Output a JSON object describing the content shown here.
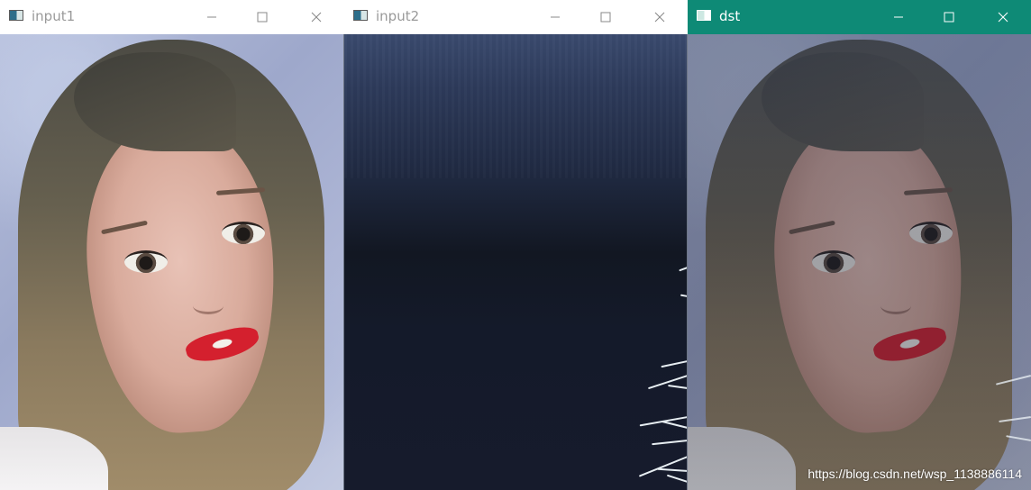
{
  "windows": [
    {
      "title": "input1",
      "active": false,
      "image": "girl-portrait"
    },
    {
      "title": "input2",
      "active": false,
      "image": "dark-blue-background"
    },
    {
      "title": "dst",
      "active": true,
      "image": "blended-portrait",
      "watermark": "https://blog.csdn.net/wsp_1138886114"
    }
  ],
  "colors": {
    "active_titlebar": "#0e8a76",
    "inactive_titlebar": "#ffffff",
    "lip_red": "#d4202e"
  },
  "icons": {
    "app": "app-window-icon",
    "minimize": "minimize-icon",
    "maximize": "maximize-icon",
    "close": "close-icon"
  }
}
